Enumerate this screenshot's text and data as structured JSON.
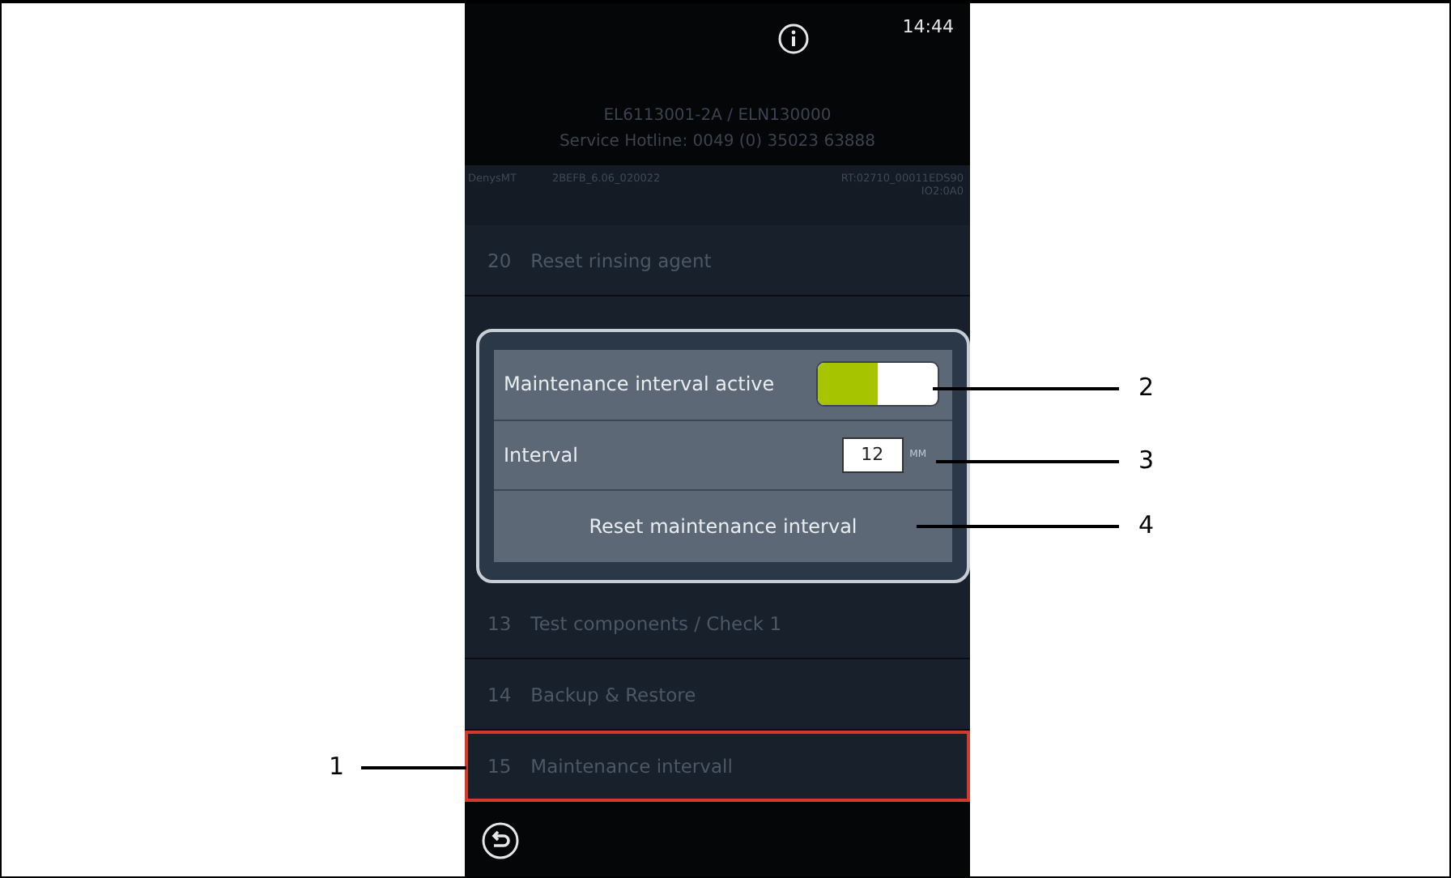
{
  "header": {
    "time": "14:44",
    "device": "EL6113001-2A / ELN130000",
    "hotline": "Service Hotline: 0049 (0) 35023 63888",
    "info_left": [
      "DenysMT",
      "2BEFB_6.06_020022"
    ],
    "info_right": [
      "RT:02710_00011EDS90",
      "IO2:0A0"
    ]
  },
  "menu_top": [
    {
      "number": "20",
      "label": "Reset rinsing agent",
      "selected": false
    }
  ],
  "menu_bottom": [
    {
      "number": "13",
      "label": "Test components / Check 1",
      "selected": false
    },
    {
      "number": "14",
      "label": "Backup & Restore",
      "selected": false
    },
    {
      "number": "15",
      "label": "Maintenance intervall",
      "selected": true
    }
  ],
  "dialog": {
    "toggle_label": "Maintenance interval active",
    "on": true,
    "interval_label": "Interval",
    "interval_value": "12",
    "unit": "MM",
    "reset_button": "Reset maintenance interval"
  },
  "callouts": [
    {
      "number": "1"
    },
    {
      "number": "2"
    },
    {
      "number": "3"
    },
    {
      "number": "4"
    }
  ]
}
